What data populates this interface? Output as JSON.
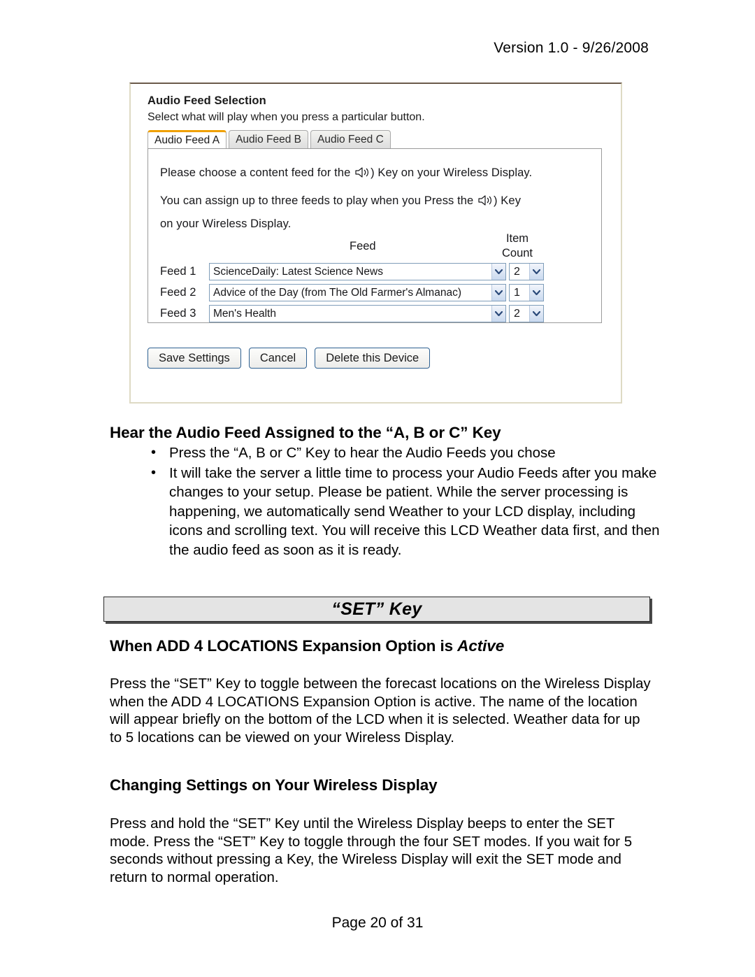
{
  "header": {
    "version_line": "Version 1.0 - 9/26/2008"
  },
  "screenshot": {
    "panel_title": "Audio Feed Selection",
    "panel_subtitle": "Select what will play when you press a particular button.",
    "tabs": [
      {
        "label": "Audio Feed A",
        "active": true
      },
      {
        "label": "Audio Feed B",
        "active": false
      },
      {
        "label": "Audio Feed C",
        "active": false
      }
    ],
    "instructions": {
      "line1_before": "Please choose a content feed for the",
      "line1_after": ") Key on your Wireless Display.",
      "line2_before": "You can assign up to three feeds to play when you Press the",
      "line2_after": ") Key",
      "line3": "on your Wireless Display.",
      "speaker_icon": "speaker-icon"
    },
    "table": {
      "col_feed": "Feed",
      "col_item_count_line1": "Item",
      "col_item_count_line2": "Count",
      "rows": [
        {
          "label": "Feed 1",
          "feed": "ScienceDaily: Latest Science News",
          "count": "2"
        },
        {
          "label": "Feed 2",
          "feed": "Advice of the Day (from The Old Farmer's Almanac)",
          "count": "1"
        },
        {
          "label": "Feed 3",
          "feed": "Men's Health",
          "count": "2"
        }
      ]
    },
    "buttons": {
      "save": "Save Settings",
      "cancel": "Cancel",
      "delete": "Delete this Device"
    },
    "colors": {
      "active_tab_accent": "#f0a000",
      "panel_border": "#dedac4",
      "button_border": "#2f6192",
      "select_border": "#7f9db9"
    }
  },
  "document": {
    "heading_audio": "Hear the Audio Feed Assigned to the “A, B or C” Key",
    "bullets": [
      "Press the “A, B or C” Key to hear the Audio Feeds  you chose",
      "It will take the server a little time to process your Audio Feeds after you make changes to your setup.  Please be patient.  While the server processing is happening, we automatically send Weather to your LCD display, including icons and scrolling text.  You will receive this LCD Weather data first, and then the audio feed as soon as it is ready."
    ],
    "banner_title": "“SET” Key",
    "heading_when_prefix": "When ADD 4 LOCATIONS Expansion Option is ",
    "heading_when_italic": "Active",
    "paragraph_set": "Press the “SET” Key to toggle between the forecast locations on the Wireless Display when the ADD 4 LOCATIONS Expansion Option is active. The name of the location will appear briefly on the bottom of the LCD when it is selected. Weather data for up to 5 locations can be viewed on your Wireless Display.",
    "heading_changing": "Changing Settings on Your Wireless Display",
    "paragraph_changing": "Press and hold the “SET” Key until the Wireless Display beeps to enter the SET mode. Press the “SET” Key to toggle through the four SET modes.  If you wait for 5 seconds without pressing a Key, the Wireless Display will exit the SET mode and return to normal operation."
  },
  "footer": {
    "page_label": "Page 20 of 31"
  }
}
